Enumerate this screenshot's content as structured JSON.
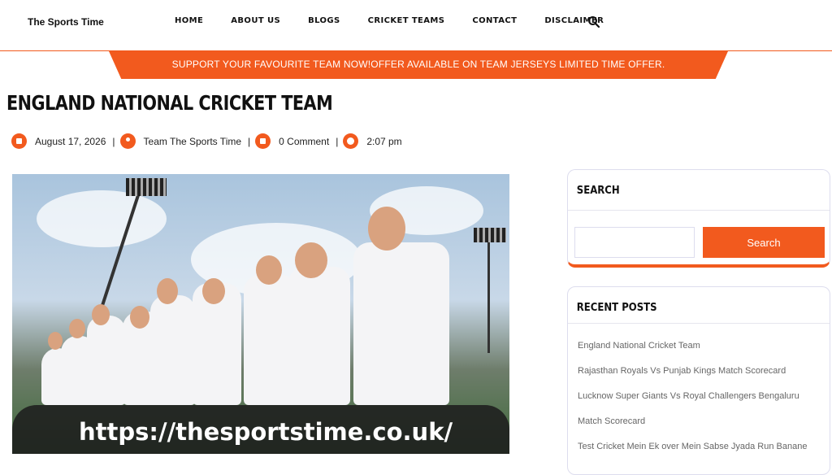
{
  "header": {
    "logo": "The Sports Time",
    "nav": [
      "HOME",
      "ABOUT US",
      "BLOGS",
      "CRICKET TEAMS",
      "CONTACT",
      "DISCLAIMER"
    ]
  },
  "promo": "SUPPORT YOUR FAVOURITE TEAM NOW!OFFER AVAILABLE ON TEAM JERSEYS LIMITED TIME OFFER.",
  "article": {
    "title": "ENGLAND NATIONAL CRICKET TEAM",
    "date": "August 17, 2026",
    "author": "Team The Sports Time",
    "comments": "0 Comment",
    "time": "2:07 pm",
    "image_caption": "https://thesportstime.co.uk/"
  },
  "sidebar": {
    "search": {
      "title": "SEARCH",
      "button": "Search",
      "placeholder": ""
    },
    "recent": {
      "title": "RECENT POSTS",
      "items": [
        "England National Cricket Team",
        "Rajasthan Royals Vs Punjab Kings Match Scorecard",
        "Lucknow Super Giants Vs Royal Challengers Bengaluru",
        "Match Scorecard",
        "Test Cricket Mein Ek over Mein Sabse Jyada Run Banane"
      ]
    }
  },
  "colors": {
    "accent": "#f25a1e"
  }
}
